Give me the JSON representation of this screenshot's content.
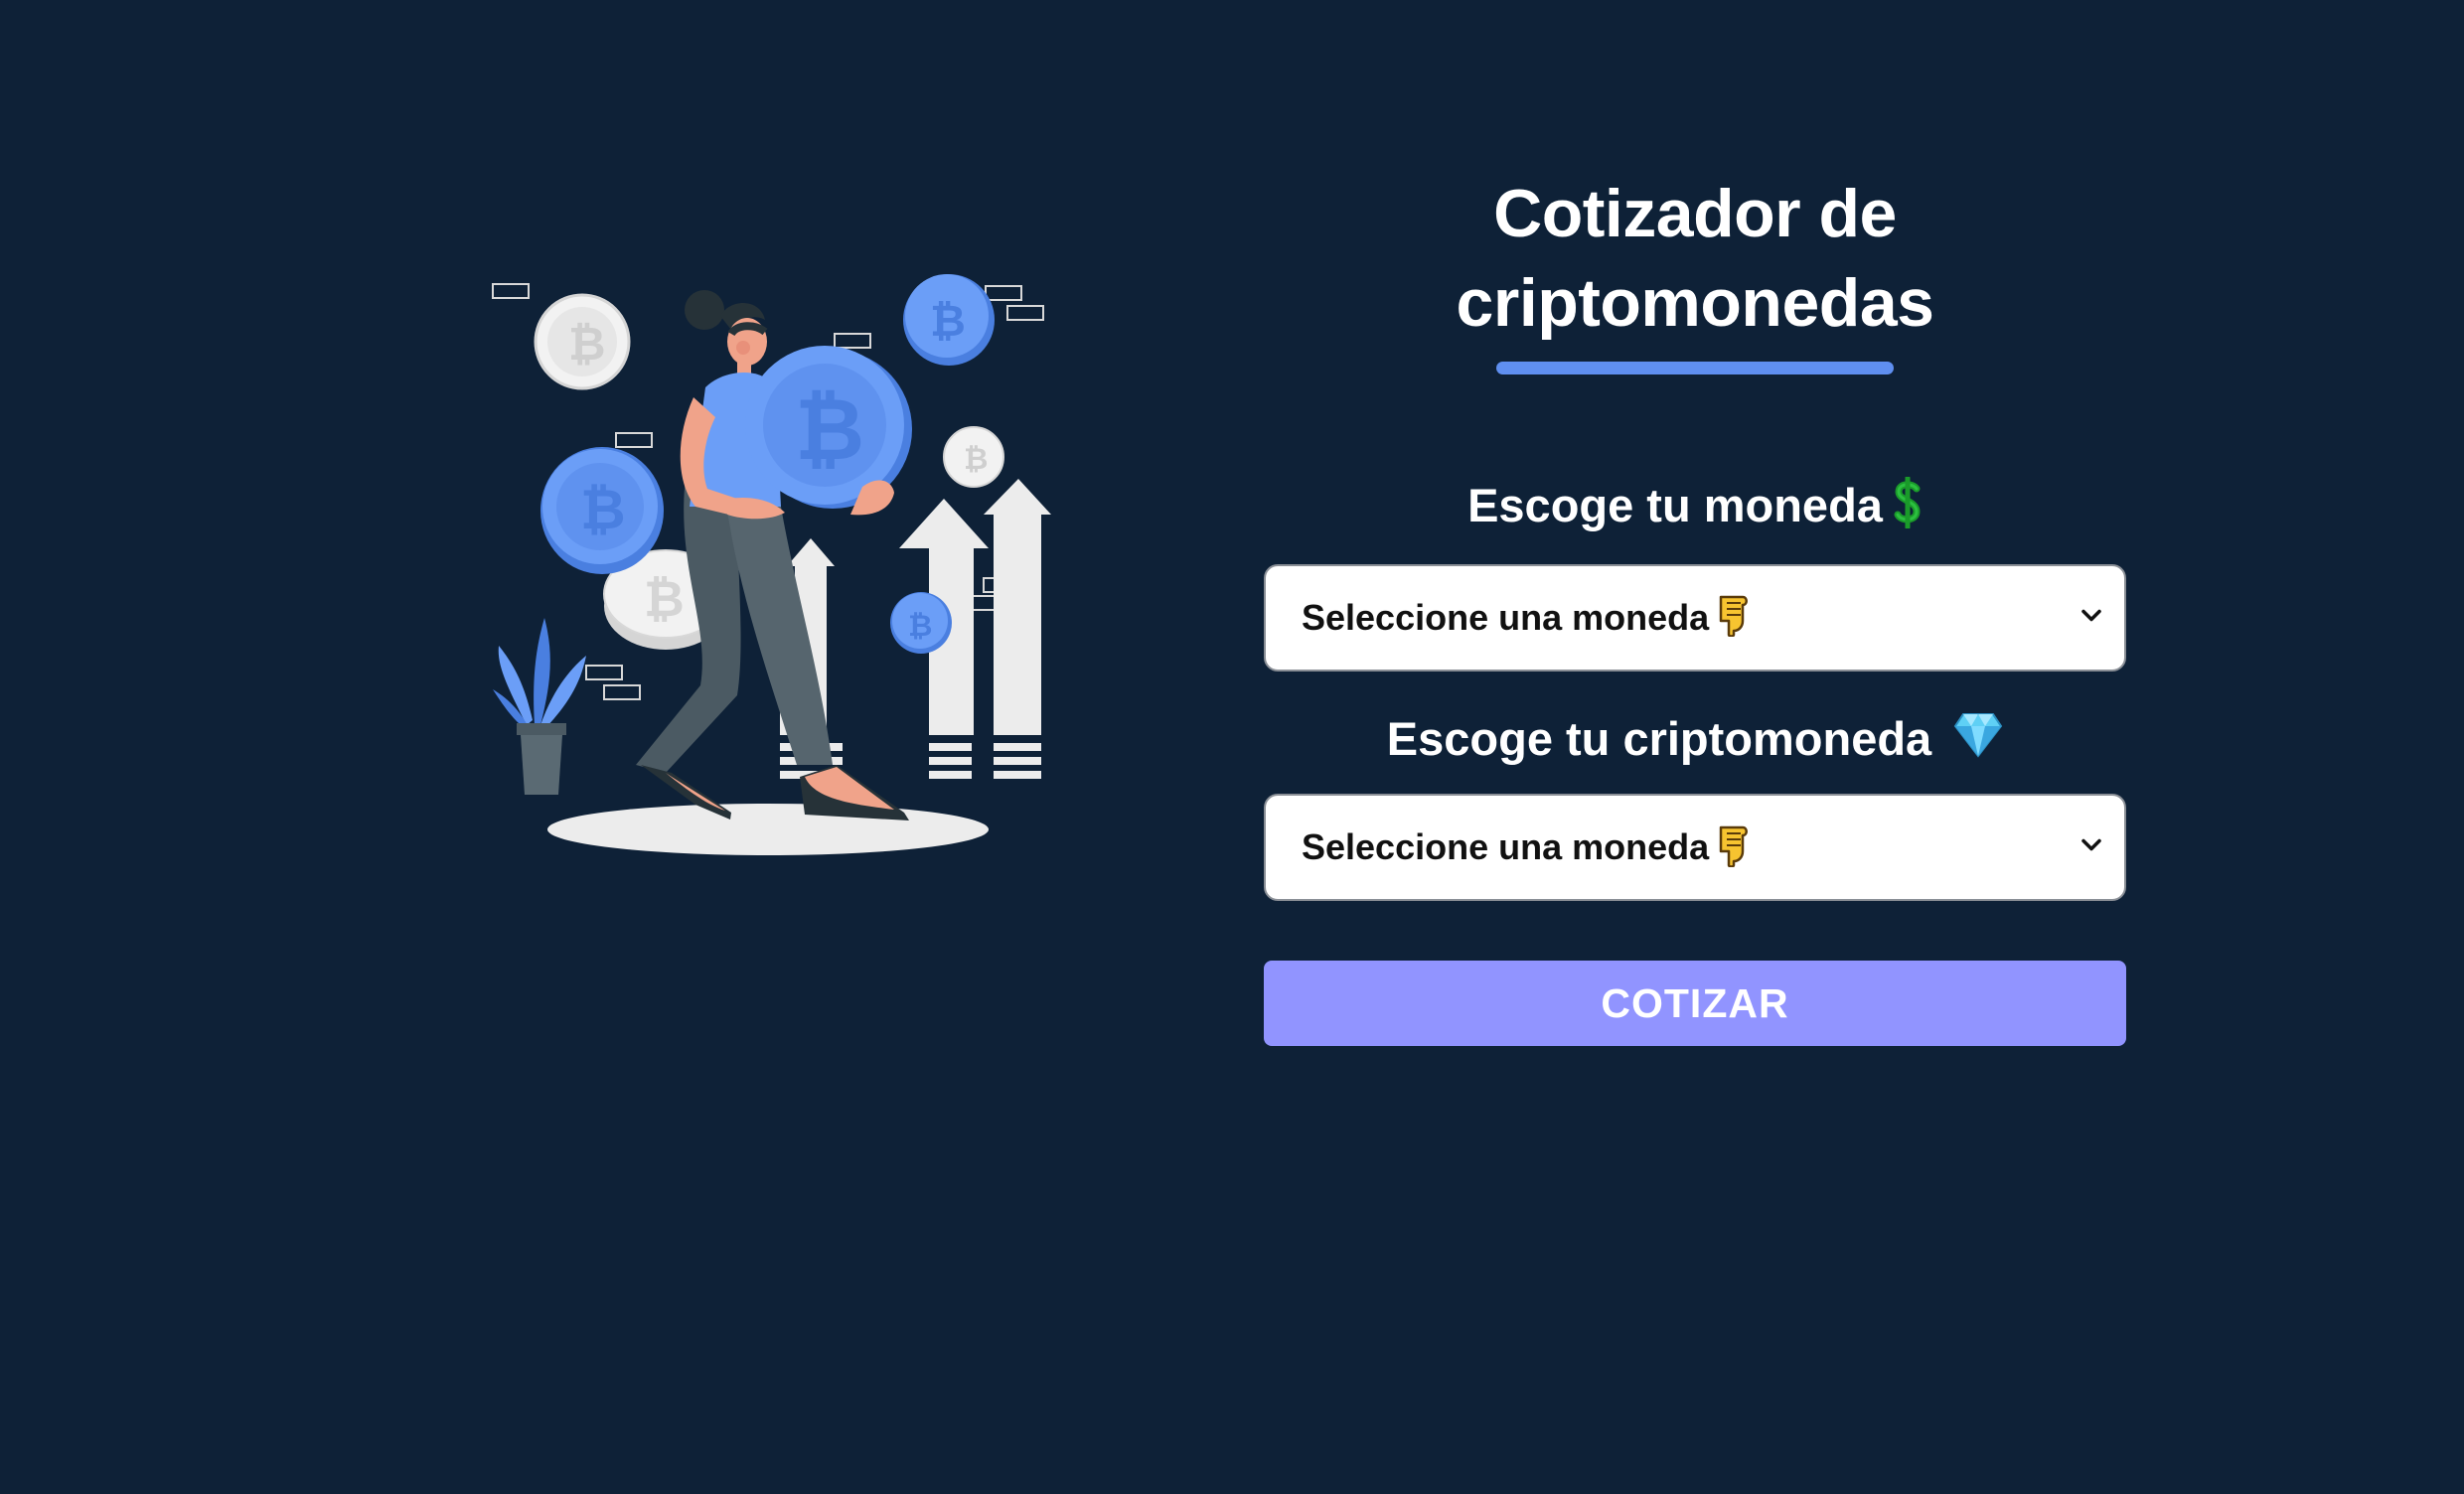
{
  "header": {
    "title": "Cotizador de criptomonedas"
  },
  "form": {
    "currency_label": "Escoge tu moneda",
    "currency_label_icon": "dollar-sign-icon",
    "currency_select_value": "Seleccione una moneda",
    "crypto_label": "Escoge tu criptomoneda",
    "crypto_label_icon": "gem-icon",
    "crypto_select_value": "Seleccione una moneda",
    "select_value_icon": "pointing-down-hand-icon",
    "submit_label": "COTIZAR"
  },
  "colors": {
    "background": "#0e2137",
    "accent": "#5f8ff0",
    "button": "#9194ff"
  },
  "illustration": {
    "icon": "crypto-person-carrying-bitcoin-illustration"
  }
}
